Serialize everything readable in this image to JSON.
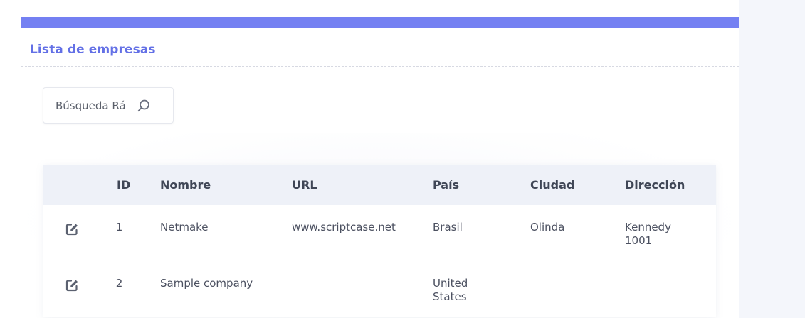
{
  "page": {
    "title": "Lista de empresas",
    "accent_color": "#7480f2"
  },
  "search": {
    "label": "Búsqueda Rá",
    "icon": "search-icon"
  },
  "table": {
    "columns": [
      "",
      "ID",
      "Nombre",
      "URL",
      "País",
      "Ciudad",
      "Dirección"
    ],
    "rows": [
      {
        "edit_icon": "edit-icon",
        "id": "1",
        "nombre": "Netmake",
        "url": "www.scriptcase.net",
        "pais": "Brasil",
        "ciudad": "Olinda",
        "direccion": "Kennedy 1001"
      },
      {
        "edit_icon": "edit-icon",
        "id": "2",
        "nombre": "Sample company",
        "url": "",
        "pais": "United States",
        "ciudad": "",
        "direccion": ""
      }
    ]
  }
}
